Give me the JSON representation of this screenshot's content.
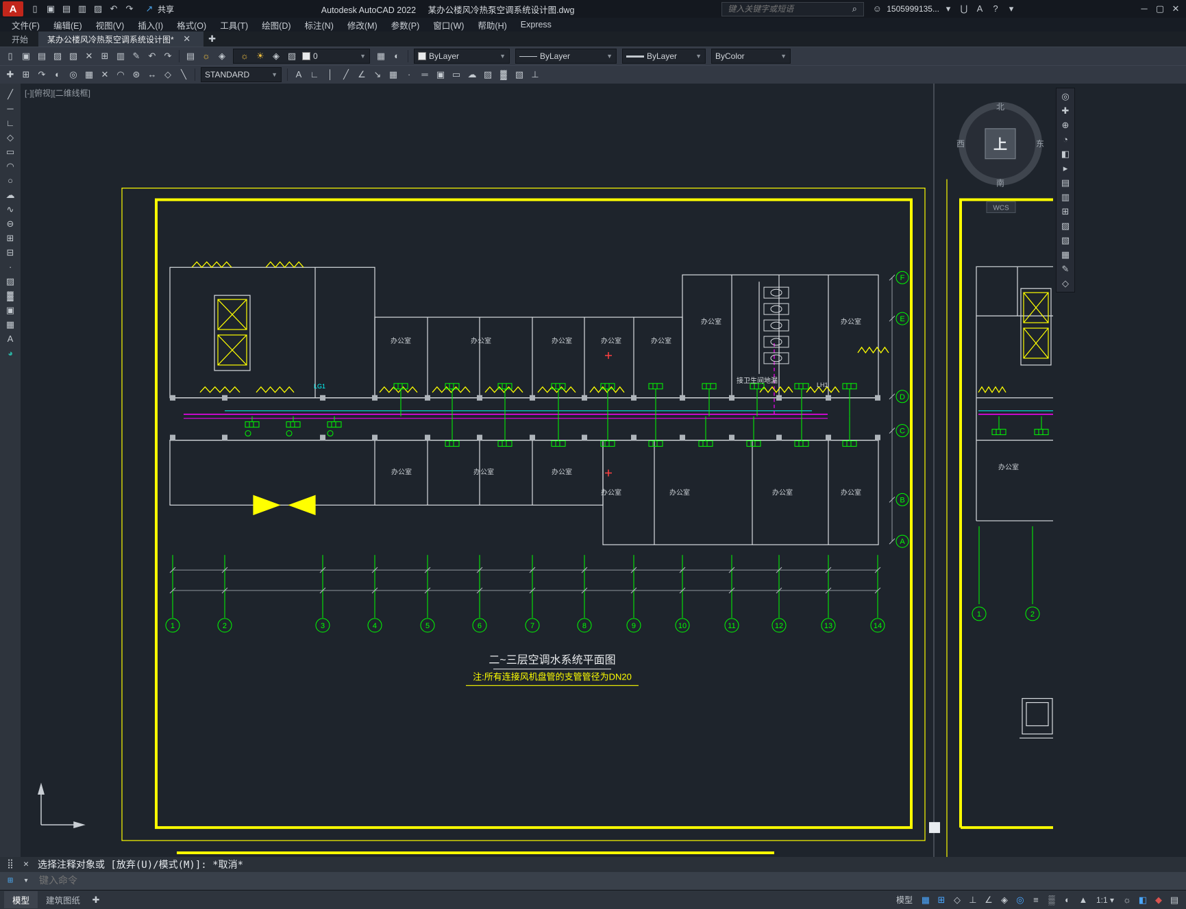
{
  "titlebar": {
    "logo_letter": "A",
    "app_title": "Autodesk AutoCAD 2022",
    "doc_title": "某办公楼风冷热泵空调系统设计图.dwg",
    "share_label": "共享",
    "search_placeholder": "键入关键字或短语",
    "user_name": "1505999135..."
  },
  "menubar": {
    "items": [
      "文件(F)",
      "编辑(E)",
      "视图(V)",
      "插入(I)",
      "格式(O)",
      "工具(T)",
      "绘图(D)",
      "标注(N)",
      "修改(M)",
      "参数(P)",
      "窗口(W)",
      "帮助(H)",
      "Express"
    ]
  },
  "tabbar": {
    "start_tab": "开始",
    "drawing_tab": "某办公楼风冷热泵空调系统设计图*"
  },
  "ribbon": {
    "layer_value": "0",
    "color_value": "ByLayer",
    "linetype_value": "ByLayer",
    "lineweight_value": "ByLayer",
    "plotstyle_value": "ByColor",
    "text_style_value": "STANDARD"
  },
  "canvas": {
    "viewport_label": "[-][俯视][二维线框]",
    "wcs_label": "WCS",
    "compass": {
      "north": "北",
      "south": "南",
      "west": "西",
      "east": "东",
      "cube": "上"
    },
    "drawing_title": "二~三层空调水系统平面图",
    "drawing_note": "注:所有连接风机盘管的支管管径为DN20",
    "room_label": "办公室",
    "bathroom_label": "接卫生间地漏",
    "riser_label_1": "LG1",
    "riser_label_2": "LH1",
    "grid_numbers": [
      "1",
      "2",
      "3",
      "4",
      "5",
      "6",
      "7",
      "8",
      "9",
      "10",
      "11",
      "12",
      "13",
      "14"
    ],
    "row_letters": [
      "F",
      "E",
      "D",
      "C",
      "B",
      "A"
    ],
    "right_sheet_numbers": [
      "1",
      "2"
    ]
  },
  "command": {
    "prompt": "选择注释对象或 [放弃(U)/模式(M)]: *取消*",
    "input_hint": "键入命令"
  },
  "statusbar": {
    "model_tab": "模型",
    "layout_tab": "建筑图纸"
  },
  "colors": {
    "accent_blue": "#49a6ff",
    "cad_yellow": "#ffff00",
    "cad_green": "#00ff00",
    "cad_magenta": "#ff00ff",
    "cad_cyan": "#00ffff"
  },
  "toolbars": {
    "qat": [
      {
        "name": "new-file",
        "glyph": "▯"
      },
      {
        "name": "open-file",
        "glyph": "▣"
      },
      {
        "name": "save",
        "glyph": "▤"
      },
      {
        "name": "save-as",
        "glyph": "▥"
      },
      {
        "name": "plot",
        "glyph": "▨"
      },
      {
        "name": "undo",
        "glyph": "↶"
      },
      {
        "name": "redo",
        "glyph": "↷"
      }
    ],
    "window_controls": [
      {
        "name": "minimize-window",
        "glyph": "─"
      },
      {
        "name": "maximize-window",
        "glyph": "▢"
      },
      {
        "name": "close-window",
        "glyph": "✕"
      }
    ],
    "infocenter_more": [
      {
        "name": "user-menu-arrow",
        "glyph": "▾"
      },
      {
        "name": "cart",
        "glyph": "⋃"
      },
      {
        "name": "autodesk-app-menu",
        "glyph": "A"
      },
      {
        "name": "help",
        "glyph": "?"
      },
      {
        "name": "help-menu-arrow",
        "glyph": "▾"
      }
    ],
    "search_button": [
      {
        "name": "search",
        "glyph": "⌕"
      }
    ],
    "user_avatar": [
      {
        "name": "user-avatar",
        "glyph": "☺"
      }
    ],
    "tab_close": [
      {
        "name": "close-tab",
        "glyph": "✕"
      }
    ],
    "tab_add": [
      {
        "name": "new-tab",
        "glyph": "✚"
      }
    ],
    "ribbon1_left": [
      {
        "name": "new-file",
        "glyph": "▯"
      },
      {
        "name": "open-file",
        "glyph": "▣"
      },
      {
        "name": "save",
        "glyph": "▤"
      },
      {
        "name": "plot",
        "glyph": "▨"
      },
      {
        "name": "publish",
        "glyph": "▧"
      },
      {
        "name": "cut",
        "glyph": "✕"
      },
      {
        "name": "copy-clip",
        "glyph": "⊞"
      },
      {
        "name": "paste",
        "glyph": "▥"
      },
      {
        "name": "match-properties",
        "glyph": "✎"
      },
      {
        "name": "undo",
        "glyph": "↶"
      },
      {
        "name": "redo",
        "glyph": "↷"
      }
    ],
    "layer_tools": [
      {
        "name": "layer-properties",
        "glyph": "▤"
      },
      {
        "name": "layer-off",
        "glyph": "☼",
        "color": "#f0c040"
      },
      {
        "name": "layer-isolate",
        "glyph": "◈"
      }
    ],
    "layer_combo_icons": [
      {
        "name": "layer-on-bulb",
        "glyph": "☼",
        "color": "#f0c040"
      },
      {
        "name": "layer-thaw-sun",
        "glyph": "☀",
        "color": "#f0c040"
      },
      {
        "name": "layer-lock",
        "glyph": "◈"
      },
      {
        "name": "layer-plot",
        "glyph": "▨"
      }
    ],
    "layer_extra": [
      {
        "name": "layer-states",
        "glyph": "▦"
      },
      {
        "name": "layer-previous",
        "glyph": "◐"
      }
    ],
    "ribbon2_left": [
      {
        "name": "move",
        "glyph": "✚"
      },
      {
        "name": "copy-object",
        "glyph": "⊞"
      },
      {
        "name": "rotate",
        "glyph": "↷"
      },
      {
        "name": "mirror",
        "glyph": "◐"
      },
      {
        "name": "offset",
        "glyph": "◎"
      },
      {
        "name": "array",
        "glyph": "▦"
      },
      {
        "name": "trim",
        "glyph": "✕"
      },
      {
        "name": "fillet",
        "glyph": "◠"
      },
      {
        "name": "explode",
        "glyph": "⊛"
      },
      {
        "name": "stretch",
        "glyph": "↔"
      },
      {
        "name": "scale",
        "glyph": "◇"
      },
      {
        "name": "chamfer",
        "glyph": "╲"
      }
    ],
    "ribbon2_right": [
      {
        "name": "text-style",
        "glyph": "A"
      },
      {
        "name": "dim-style",
        "glyph": "∟"
      },
      {
        "name": "dim-linear",
        "glyph": "│"
      },
      {
        "name": "dim-aligned",
        "glyph": "╱"
      },
      {
        "name": "dim-angular",
        "glyph": "∠"
      },
      {
        "name": "multileader",
        "glyph": "↘"
      },
      {
        "name": "table",
        "glyph": "▦"
      },
      {
        "name": "point-style",
        "glyph": "∙"
      },
      {
        "name": "multiline",
        "glyph": "═"
      },
      {
        "name": "region",
        "glyph": "▣"
      },
      {
        "name": "boundary",
        "glyph": "▭"
      },
      {
        "name": "revision-cloud",
        "glyph": "☁"
      },
      {
        "name": "hatch",
        "glyph": "▨"
      },
      {
        "name": "gradient",
        "glyph": "▓"
      },
      {
        "name": "wipeout",
        "glyph": "▧"
      },
      {
        "name": "measure",
        "glyph": "⊥"
      }
    ],
    "left_toolbar": [
      {
        "name": "line",
        "glyph": "╱"
      },
      {
        "name": "construction-line",
        "glyph": "─"
      },
      {
        "name": "polyline",
        "glyph": "∟"
      },
      {
        "name": "polygon",
        "glyph": "◇"
      },
      {
        "name": "rectangle",
        "glyph": "▭"
      },
      {
        "name": "arc",
        "glyph": "◠"
      },
      {
        "name": "circle",
        "glyph": "○"
      },
      {
        "name": "revision-cloud",
        "glyph": "☁"
      },
      {
        "name": "spline",
        "glyph": "∿"
      },
      {
        "name": "ellipse",
        "glyph": "⊖"
      },
      {
        "name": "insert-block",
        "glyph": "⊞"
      },
      {
        "name": "create-block",
        "glyph": "⊟"
      },
      {
        "name": "point",
        "glyph": "∙"
      },
      {
        "name": "hatch",
        "glyph": "▨"
      },
      {
        "name": "gradient",
        "glyph": "▓"
      },
      {
        "name": "region",
        "glyph": "▣"
      },
      {
        "name": "table",
        "glyph": "▦"
      },
      {
        "name": "multiline-text",
        "glyph": "A"
      },
      {
        "name": "tool-palettes",
        "glyph": "◕",
        "color": "#2bb3a3"
      }
    ],
    "nav_right": [
      {
        "name": "full-navigation-wheel",
        "glyph": "◎"
      },
      {
        "name": "pan",
        "glyph": "✚"
      },
      {
        "name": "zoom",
        "glyph": "⊕"
      },
      {
        "name": "orbit",
        "glyph": "◔"
      },
      {
        "name": "viewcube-home",
        "glyph": "◧"
      },
      {
        "name": "show-motion",
        "glyph": "▸"
      },
      {
        "name": "properties-palette",
        "glyph": "▤"
      },
      {
        "name": "layers-palette",
        "glyph": "▥"
      },
      {
        "name": "blocks-palette",
        "glyph": "⊞"
      },
      {
        "name": "hatch-palette",
        "glyph": "▨"
      },
      {
        "name": "xref-palette",
        "glyph": "▧"
      },
      {
        "name": "sheet-set-palette",
        "glyph": "▦"
      },
      {
        "name": "markup",
        "glyph": "✎"
      },
      {
        "name": "measure-tool",
        "glyph": "◇"
      }
    ],
    "cmd_controls": [
      {
        "name": "command-grip",
        "glyph": "⣿"
      },
      {
        "name": "close-command",
        "glyph": "✕"
      }
    ],
    "cmd_input_icons": [
      {
        "name": "recent-commands",
        "glyph": "⊞",
        "color": "#4aa3e8"
      },
      {
        "name": "recent-commands-arrow",
        "glyph": "▾"
      }
    ],
    "layout_add": [
      {
        "name": "new-layout",
        "glyph": "✚"
      }
    ],
    "status_icons": [
      {
        "name": "model-space-toggle",
        "text": "模型"
      },
      {
        "name": "grid-toggle",
        "glyph": "▦",
        "active": true
      },
      {
        "name": "snap-toggle",
        "glyph": "⊞",
        "active": true
      },
      {
        "name": "infer-constraints",
        "glyph": "◇"
      },
      {
        "name": "ortho-toggle",
        "glyph": "⊥"
      },
      {
        "name": "polar-toggle",
        "glyph": "∠"
      },
      {
        "name": "isodraft-toggle",
        "glyph": "◈"
      },
      {
        "name": "osnap-toggle",
        "glyph": "◎",
        "active": true
      },
      {
        "name": "lineweight-toggle",
        "glyph": "≡"
      },
      {
        "name": "transparency-toggle",
        "glyph": "▒"
      },
      {
        "name": "selection-cycling",
        "glyph": "◐"
      },
      {
        "name": "annotation-visibility",
        "glyph": "▲"
      },
      {
        "name": "annotation-scale",
        "text": "1:1 ▾"
      },
      {
        "name": "workspace-switch",
        "glyph": "☼"
      },
      {
        "name": "graphics-performance",
        "glyph": "◧",
        "active": true
      },
      {
        "name": "record",
        "glyph": "◆",
        "color": "#d9534f"
      },
      {
        "name": "customize-menu",
        "glyph": "▤"
      }
    ]
  }
}
